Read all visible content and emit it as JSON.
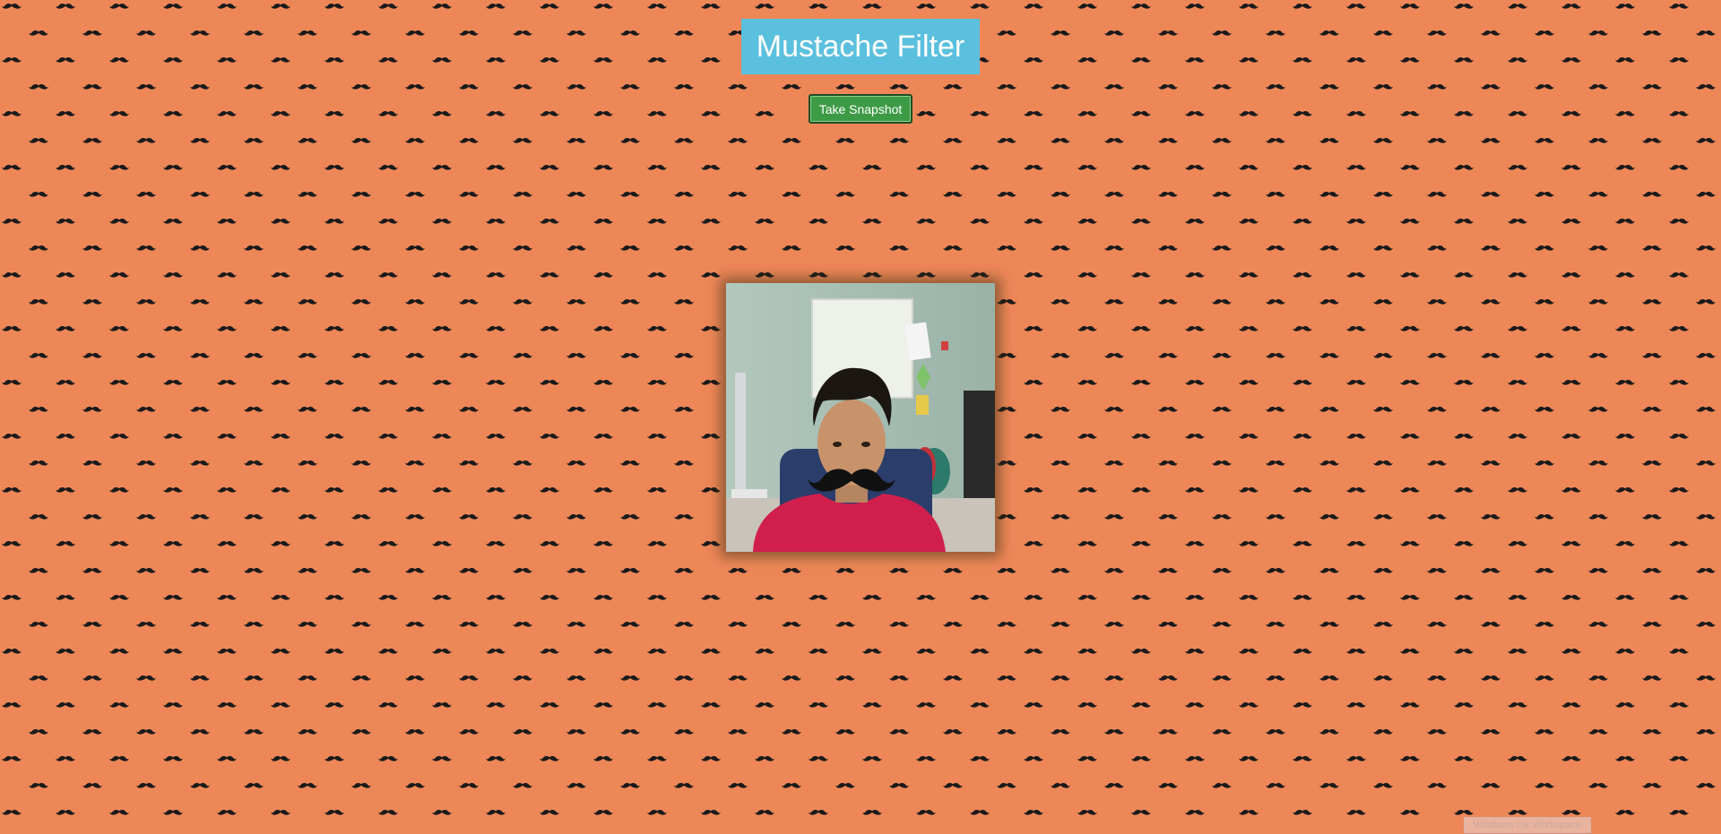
{
  "page": {
    "background_color": "#ee8758",
    "pattern_icon": "mustache-icon",
    "pattern_color": "#1a1a1a"
  },
  "header": {
    "title": "Mustache Filter",
    "title_bg": "#5bc0de"
  },
  "controls": {
    "snapshot_label": "Take Snapshot",
    "snapshot_color": "#3d9b45"
  },
  "video": {
    "overlay_icon": "mustache-icon"
  },
  "system": {
    "ink_workspace_label": "Windows Ink Workspace"
  }
}
